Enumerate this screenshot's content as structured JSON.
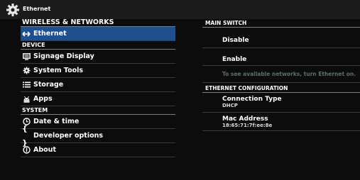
{
  "titlebar": {
    "title": "Ethernet",
    "icon": "gear-icon"
  },
  "sidebar": {
    "sections": [
      {
        "header": "WIRELESS & NETWORKS",
        "items": [
          {
            "label": "Ethernet",
            "icon": "arrows-left-right-icon",
            "selected": true
          }
        ]
      },
      {
        "header": "DEVICE",
        "items": [
          {
            "label": "Signage Display",
            "icon": "display-icon"
          },
          {
            "label": "System Tools",
            "icon": "gear-icon"
          },
          {
            "label": "Storage",
            "icon": "list-icon"
          },
          {
            "label": "Apps",
            "icon": "android-icon"
          }
        ]
      },
      {
        "header": "SYSTEM",
        "items": [
          {
            "label": "Date & time",
            "icon": "clock-icon"
          },
          {
            "label": "Developer options",
            "icon": "braces-icon"
          },
          {
            "label": "About",
            "icon": "info-icon"
          }
        ]
      }
    ]
  },
  "main": {
    "main_switch_header": "MAIN SWITCH",
    "disable_label": "Disable",
    "enable_label": "Enable",
    "note": "To see available networks, turn Ethernet on.",
    "eth_config_header": "ETHERNET CONFIGURATION",
    "connection_type_label": "Connection Type",
    "connection_type_value": "DHCP",
    "mac_label": "Mac Address",
    "mac_value": "18:65:71:7f:ee:8e"
  },
  "colors": {
    "selected_bg": "#1f4f8f",
    "note_text": "#5f6f6f",
    "background": "#0c0c0c"
  }
}
